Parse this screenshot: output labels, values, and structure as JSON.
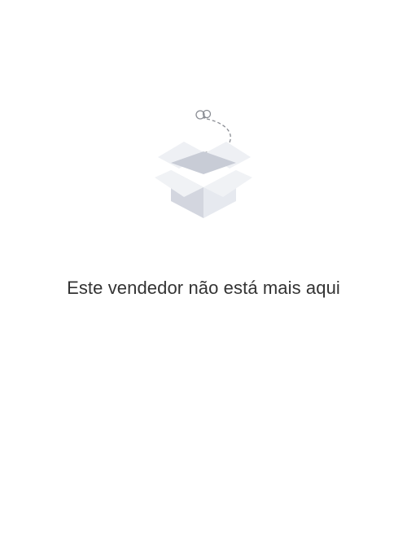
{
  "empty_state": {
    "illustration_icon": "open-box-with-flying-bug-icon",
    "message": "Este vendedor não está mais aqui"
  },
  "colors": {
    "background": "#ffffff",
    "text": "#333333",
    "box_front": "#d3d6df",
    "box_side": "#e6e9ef",
    "box_flap": "#eef0f4",
    "dashed_trail": "#8a8d94"
  }
}
